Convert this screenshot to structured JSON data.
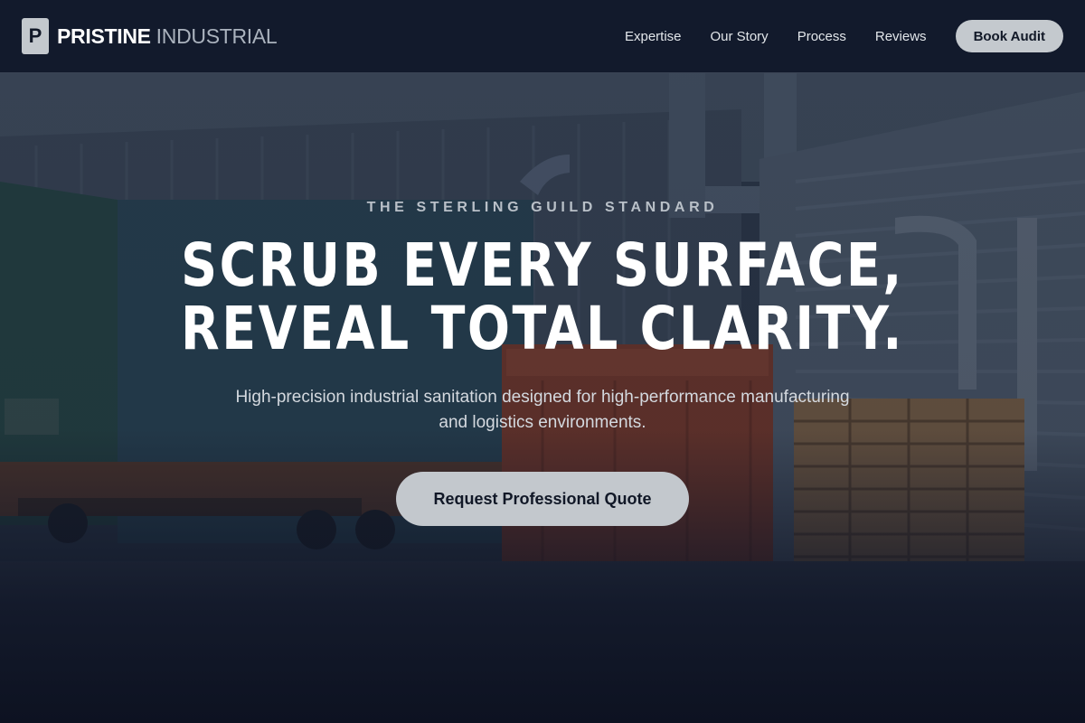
{
  "brand": {
    "logo_letter": "P",
    "name_strong": "PRISTINE",
    "name_light": "INDUSTRIAL"
  },
  "nav": {
    "links": [
      "Expertise",
      "Our Story",
      "Process",
      "Reviews"
    ],
    "cta_label": "Book Audit"
  },
  "hero": {
    "eyebrow": "THE STERLING GUILD STANDARD",
    "headline_line1": "SCRUB EVERY SURFACE,",
    "headline_line2": "REVEAL TOTAL CLARITY.",
    "subheadline": "High-precision industrial sanitation designed for high-performance manufacturing and logistics environments.",
    "cta_label": "Request Professional Quote"
  },
  "colors": {
    "nav_background": "#121a2c",
    "page_background": "#0f172a",
    "button_background": "#c3c8cd",
    "button_text": "#111827",
    "headline_text": "#ffffff"
  }
}
